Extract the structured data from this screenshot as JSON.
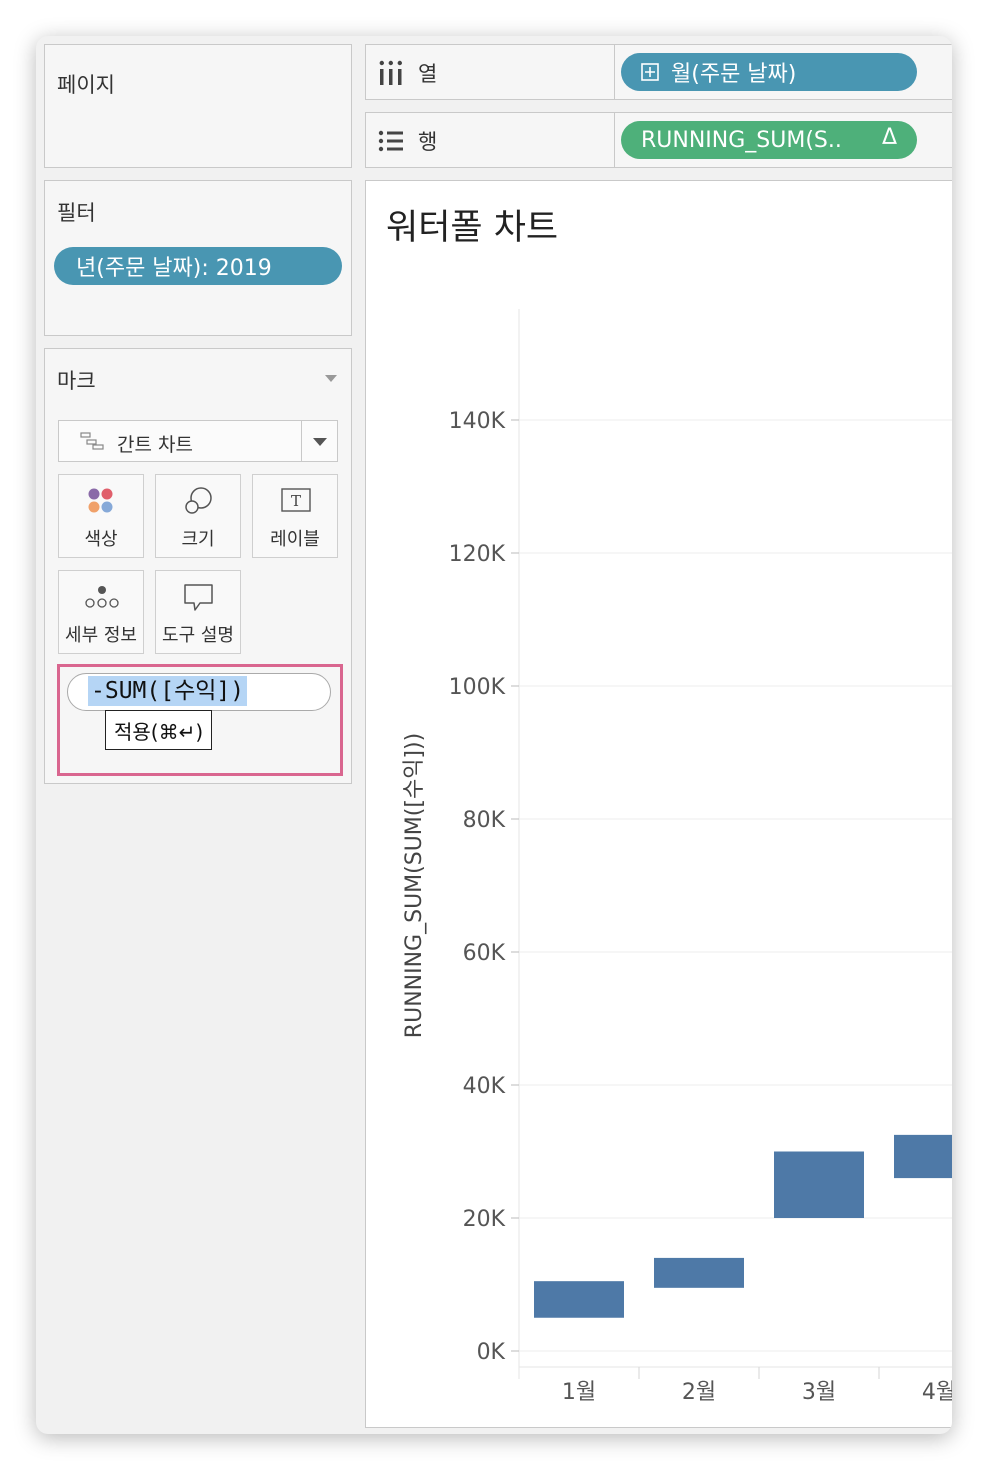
{
  "pages_panel": {
    "title": "페이지"
  },
  "filters_panel": {
    "title": "필터",
    "pill": "년(주문 날짜): 2019"
  },
  "marks_panel": {
    "title": "마크",
    "mark_type": "간트 차트",
    "buttons": {
      "color": "색상",
      "size": "크기",
      "label": "레이블",
      "detail": "세부 정보",
      "tooltip": "도구 설명"
    },
    "formula_editor": {
      "text": "-SUM([수익])",
      "apply_tooltip": "적용(⌘↵)"
    }
  },
  "shelves": {
    "columns": {
      "label": "열",
      "pill": "월(주문 날짜)"
    },
    "rows": {
      "label": "행",
      "pill": "RUNNING_SUM(S..",
      "delta_symbol": "Δ"
    }
  },
  "colors": {
    "accent_blue": "#4996b2",
    "accent_green": "#4eb07a",
    "bar": "#4e79a7",
    "highlight": "#d9668f"
  },
  "chart_data": {
    "type": "gantt",
    "title": "워터폴 차트",
    "ylabel": "RUNNING_SUM(SUM([수익]))",
    "xlabel": "",
    "ylim": [
      0,
      160000
    ],
    "yticks": [
      0,
      20000,
      40000,
      60000,
      80000,
      100000,
      120000,
      140000
    ],
    "ytick_labels": [
      "0K",
      "20K",
      "40K",
      "60K",
      "80K",
      "100K",
      "120K",
      "140K"
    ],
    "categories": [
      "1월",
      "2월",
      "3월",
      "4월"
    ],
    "bars": [
      {
        "category": "1월",
        "start": 10500,
        "end": 5000
      },
      {
        "category": "2월",
        "start": 14000,
        "end": 9500
      },
      {
        "category": "3월",
        "start": 30000,
        "end": 20000
      },
      {
        "category": "4월",
        "start": 32500,
        "end": 26000
      }
    ],
    "grid": true
  }
}
